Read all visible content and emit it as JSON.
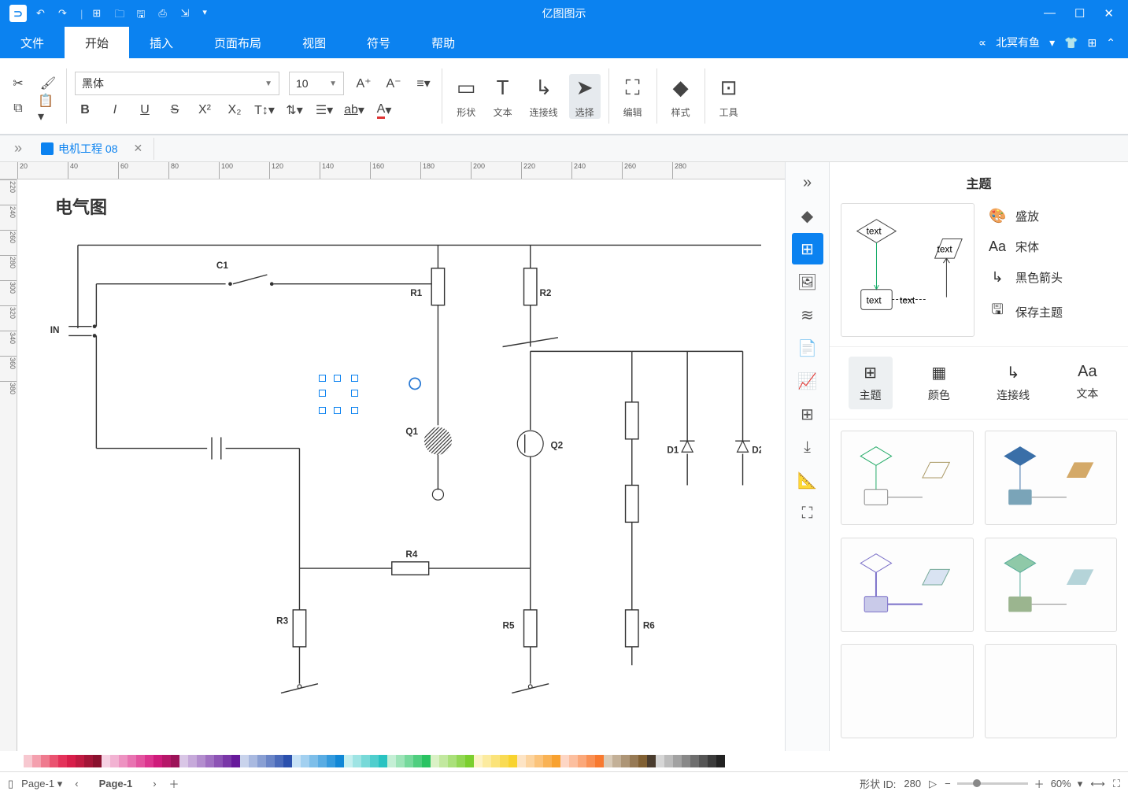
{
  "app": {
    "title": "亿图图示"
  },
  "titlebar_icons": [
    "undo",
    "redo",
    "divider",
    "new",
    "open",
    "save",
    "print",
    "export"
  ],
  "user": {
    "name": "北冥有鱼"
  },
  "menus": [
    "文件",
    "开始",
    "插入",
    "页面布局",
    "视图",
    "符号",
    "帮助"
  ],
  "menu_active_index": 1,
  "ribbon": {
    "font_name": "黑体",
    "font_size": "10",
    "shape_label": "形状",
    "text_label": "文本",
    "connector_label": "连接线",
    "select_label": "选择",
    "edit_label": "编辑",
    "style_label": "样式",
    "tools_label": "工具"
  },
  "doc_tab": {
    "name": "电机工程 08"
  },
  "ruler_h": [
    "20",
    "40",
    "60",
    "80",
    "100",
    "120",
    "140",
    "160",
    "180",
    "200",
    "220",
    "240",
    "260",
    "280"
  ],
  "ruler_v": [
    "220",
    "240",
    "260",
    "280",
    "300",
    "320",
    "340",
    "360",
    "380"
  ],
  "diagram": {
    "title": "电气图",
    "labels": {
      "IN": "IN",
      "C1": "C1",
      "R1": "R1",
      "R2": "R2",
      "Q1": "Q1",
      "Q2": "Q2",
      "D1": "D1",
      "D2": "D2",
      "R3": "R3",
      "R4": "R4",
      "R5": "R5",
      "R6": "R6"
    }
  },
  "panel": {
    "title": "主题",
    "opts": {
      "color": "盛放",
      "font": "宋体",
      "arrow": "黑色箭头",
      "save": "保存主题"
    },
    "preview_text": "text",
    "tabs": [
      "主题",
      "颜色",
      "连接线",
      "文本"
    ],
    "tab_active_index": 0
  },
  "status": {
    "page_current": "Page-1",
    "page_tab": "Page-1",
    "shape_id_label": "形状 ID:",
    "shape_id_value": "280",
    "zoom": "60%"
  },
  "color_swatches": [
    "#f7c8d0",
    "#f4a0ae",
    "#ef7a8e",
    "#ea5370",
    "#e4325a",
    "#d81e4a",
    "#c01a41",
    "#a31537",
    "#8a112e",
    "#f6d1e3",
    "#f2b2d2",
    "#ed92c1",
    "#e873b1",
    "#e3539f",
    "#dc348e",
    "#cf1b7b",
    "#b61769",
    "#9c1358",
    "#d9c6e6",
    "#c6a9da",
    "#b38dce",
    "#a070c2",
    "#8d53b5",
    "#7a37a8",
    "#671a9b",
    "#c9d3ec",
    "#a9b9e0",
    "#899fd3",
    "#6a85c7",
    "#4a6aba",
    "#2b50ad",
    "#c7e2f6",
    "#a2d0f0",
    "#7dbee9",
    "#59ace3",
    "#349add",
    "#1187d6",
    "#c5efef",
    "#9ee4e4",
    "#77d9d8",
    "#50cecd",
    "#29c3c1",
    "#c4efd5",
    "#9de4b8",
    "#76d99c",
    "#4fce7f",
    "#29c362",
    "#daf1c5",
    "#c2e89f",
    "#aae07a",
    "#92d754",
    "#7bcf2e",
    "#fdf3c5",
    "#fceb9f",
    "#fbe37a",
    "#f9db54",
    "#f8d32f",
    "#fde4c5",
    "#fcd49f",
    "#fbc37a",
    "#f9b254",
    "#f8a12f",
    "#fdd6c5",
    "#fcbf9f",
    "#fba87a",
    "#f99054",
    "#f8792f",
    "#d9cbb8",
    "#c3b097",
    "#ad9576",
    "#977a55",
    "#816033",
    "#4a3c2e",
    "#d6d6d6",
    "#bcbcbc",
    "#a2a2a2",
    "#888",
    "#6e6e6e",
    "#555",
    "#3b3b3b",
    "#222"
  ]
}
